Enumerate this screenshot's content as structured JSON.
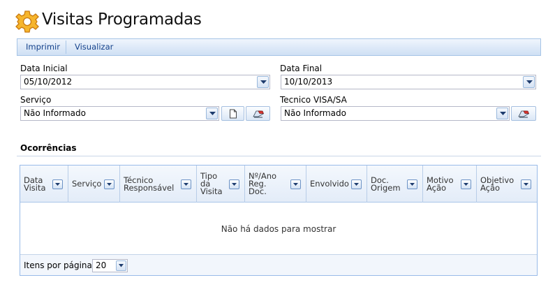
{
  "page": {
    "title": "Visitas Programadas",
    "icon": "gear-icon"
  },
  "toolbar": {
    "print_label": "Imprimir",
    "view_label": "Visualizar"
  },
  "filters": {
    "data_inicial": {
      "label": "Data Inicial",
      "value": "05/10/2012"
    },
    "data_final": {
      "label": "Data Final",
      "value": "10/10/2013"
    },
    "servico": {
      "label": "Serviço",
      "value": "Não Informado",
      "extra_icons": [
        "new-document-icon",
        "eraser-icon"
      ]
    },
    "tecnico": {
      "label": "Tecnico VISA/SA",
      "value": "Não Informado",
      "extra_icons": [
        "eraser-icon"
      ]
    }
  },
  "occurrences": {
    "title": "Ocorrências",
    "columns": [
      {
        "label": "Data\nVisita"
      },
      {
        "label": "Serviço"
      },
      {
        "label": "Técnico\nResponsável"
      },
      {
        "label": "Tipo\nda\nVisita"
      },
      {
        "label": "Nº/Ano\nReg.\nDoc."
      },
      {
        "label": "Envolvido"
      },
      {
        "label": "Doc.\nOrigem"
      },
      {
        "label": "Motivo\nAção"
      },
      {
        "label": "Objetivo\nAção"
      }
    ],
    "empty_message": "Não há dados para mostrar",
    "per_page_label": "Itens por página:",
    "per_page_value": "20"
  },
  "colors": {
    "toolbar_text": "#15428b",
    "toolbar_border": "#a6c4e6",
    "grid_border": "#99bbe8",
    "icon_orange": "#f0a020"
  }
}
